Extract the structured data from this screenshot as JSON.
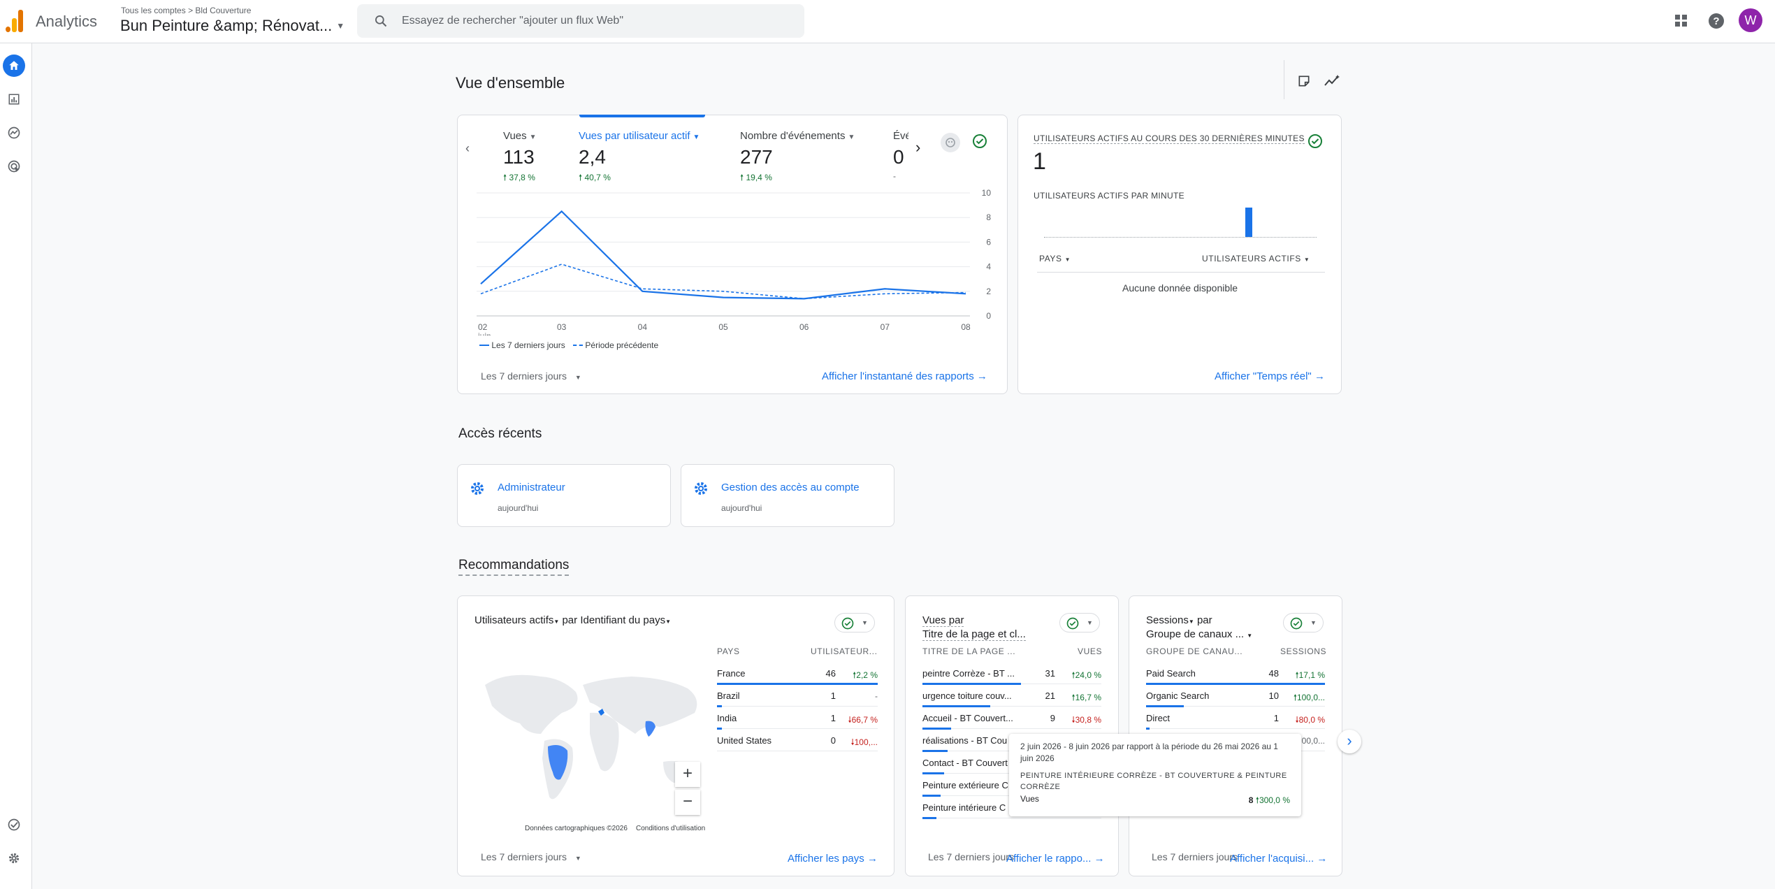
{
  "header": {
    "app_name": "Analytics",
    "breadcrumb_all": "Tous les comptes",
    "breadcrumb_account": "Bld Couverture",
    "property_name": "Bun Peinture &amp; Rénovat...",
    "search_placeholder": "Essayez de rechercher \"ajouter un flux Web\"",
    "avatar_letter": "W"
  },
  "overview": {
    "title": "Vue d'ensemble",
    "metrics": [
      {
        "label": "Vues",
        "value": "113",
        "change": "37,8 %"
      },
      {
        "label": "Vues par utilisateur actif",
        "value": "2,4",
        "change": "40,7 %"
      },
      {
        "label": "Nombre d'événements",
        "value": "277",
        "change": "19,4 %"
      },
      {
        "label": "Évé",
        "value": "0",
        "change": "-"
      }
    ],
    "legend_current": "Les 7 derniers jours",
    "legend_previous": "Période précédente",
    "date_range": "Les 7 derniers jours",
    "link": "Afficher l'instantané des rapports"
  },
  "chart_data": {
    "type": "line",
    "x": [
      "02 juin",
      "03",
      "04",
      "05",
      "06",
      "07",
      "08"
    ],
    "x_tick_labels": [
      "02",
      "03",
      "04",
      "05",
      "06",
      "07",
      "08"
    ],
    "x_sub_label": "juin",
    "ylim": [
      0,
      10
    ],
    "y_ticks": [
      "0",
      "2",
      "4",
      "6",
      "8",
      "10"
    ],
    "series": [
      {
        "name": "Les 7 derniers jours",
        "values": [
          2.6,
          8.5,
          2.0,
          1.5,
          1.4,
          2.2,
          1.8
        ],
        "style": "solid"
      },
      {
        "name": "Période précédente",
        "values": [
          1.8,
          4.2,
          2.2,
          2.0,
          1.4,
          1.8,
          1.9
        ],
        "style": "dashed"
      }
    ],
    "color": "#1a73e8"
  },
  "realtime": {
    "title": "UTILISATEURS ACTIFS AU COURS DES 30 DERNIÈRES MINUTES",
    "value": "1",
    "per_minute_label": "UTILISATEURS ACTIFS PAR MINUTE",
    "col_country": "PAYS",
    "col_users": "UTILISATEURS ACTIFS",
    "empty": "Aucune donnée disponible",
    "link": "Afficher \"Temps réel\""
  },
  "recent": {
    "title": "Accès récents",
    "items": [
      {
        "label": "Administrateur",
        "sub": "aujourd'hui"
      },
      {
        "label": "Gestion des accès au compte",
        "sub": "aujourd'hui"
      }
    ]
  },
  "recommendations": {
    "title": "Recommandations",
    "card1": {
      "metric": "Utilisateurs actifs",
      "by": "par",
      "dimension": "Identifiant du pays",
      "col1": "PAYS",
      "col2": "UTILISATEUR...",
      "rows": [
        {
          "name": "France",
          "value": "46",
          "change": "2,2 %",
          "dir": "up",
          "share": 1.0
        },
        {
          "name": "Brazil",
          "value": "1",
          "change": "-",
          "dir": "none",
          "share": 0.03
        },
        {
          "name": "India",
          "value": "1",
          "change": "66,7 %",
          "dir": "down",
          "share": 0.03
        },
        {
          "name": "United States",
          "value": "0",
          "change": "100,...",
          "dir": "down",
          "share": 0.0
        }
      ],
      "map_attribution": "Données cartographiques ©2026",
      "map_terms": "Conditions d'utilisation",
      "date_range": "Les 7 derniers jours",
      "link": "Afficher les pays"
    },
    "card2": {
      "metric": "Vues par",
      "dimension": "Titre de la page et cl...",
      "col1": "TITRE DE LA PAGE ...",
      "col2": "VUES",
      "rows": [
        {
          "name": "peintre Corrèze - BT ...",
          "value": "31",
          "change": "24,0 %",
          "dir": "up",
          "share": 0.55
        },
        {
          "name": "urgence toiture couv...",
          "value": "21",
          "change": "16,7 %",
          "dir": "up",
          "share": 0.38
        },
        {
          "name": "Accueil - BT Couvert...",
          "value": "9",
          "change": "30,8 %",
          "dir": "down",
          "share": 0.16
        },
        {
          "name": "réalisations - BT Cou",
          "value": "",
          "change": "",
          "dir": "none",
          "share": 0.14
        },
        {
          "name": "Contact - BT Couvert",
          "value": "",
          "change": "",
          "dir": "none",
          "share": 0.12
        },
        {
          "name": "Peinture extérieure C",
          "value": "",
          "change": "",
          "dir": "none",
          "share": 0.1
        },
        {
          "name": "Peinture intérieure C",
          "value": "",
          "change": "",
          "dir": "none",
          "share": 0.08
        }
      ],
      "date_range": "Les 7 derniers jours",
      "link": "Afficher le rappo..."
    },
    "card3": {
      "metric": "Sessions",
      "by": "par",
      "dimension": "Groupe de canaux ...",
      "col1": "GROUPE DE CANAU...",
      "col2": "SESSIONS",
      "rows": [
        {
          "name": "Paid Search",
          "value": "48",
          "change": "17,1 %",
          "dir": "up",
          "share": 1.0
        },
        {
          "name": "Organic Search",
          "value": "10",
          "change": "100,0...",
          "dir": "up",
          "share": 0.21
        },
        {
          "name": "Direct",
          "value": "1",
          "change": "80,0 %",
          "dir": "down",
          "share": 0.02
        },
        {
          "name": "",
          "value": "",
          "change": "00,0...",
          "dir": "none",
          "share": 0.0
        }
      ],
      "date_range": "Les 7 derniers jours",
      "link": "Afficher l'acquisi..."
    },
    "tooltip": {
      "dates": "2 juin 2026 - 8 juin 2026 par rapport à la période du 26 mai 2026 au 1 juin 2026",
      "title": "PEINTURE INTÉRIEURE CORRÈZE - BT COUVERTURE & PEINTURE CORRÈZE",
      "metric": "Vues",
      "value": "8",
      "change": "300,0 %"
    }
  }
}
